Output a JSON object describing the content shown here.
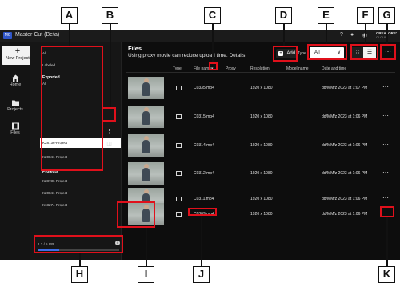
{
  "window": {
    "title": "Master Cut (Beta)",
    "logo_text": "MC",
    "brand_name": "CREATORS'",
    "brand_sub": "CLOUD"
  },
  "nav": {
    "new_project": "New Project",
    "items": [
      {
        "label": "Home",
        "icon": "home-icon"
      },
      {
        "label": "Projects",
        "icon": "folder-icon"
      },
      {
        "label": "Files",
        "icon": "film-icon"
      }
    ]
  },
  "projects_panel": {
    "all": "All",
    "labeled": "Labeled",
    "exported_header": "Exported",
    "exported_all": "All",
    "exported_items": [
      "K28736-Project",
      "K20841-Project"
    ],
    "projects_header": "Projects",
    "project_items": [
      "K28736-Project",
      "K20841-Project",
      "K18274-Project"
    ],
    "storage_text": "1.3 / 5 GB",
    "storage_used_fraction": 0.26
  },
  "main": {
    "title": "Files",
    "subtitle": "Using proxy movie can reduce upload time.",
    "details_link": "Details",
    "add_label": "Add",
    "type_label": "Type",
    "type_value": "All",
    "columns": [
      "Type",
      "File name",
      "Proxy",
      "Resolution",
      "Model name",
      "Date and time"
    ],
    "rows": [
      {
        "file": "C0335.mp4",
        "resolution": "1920 x 1080",
        "date": "dd/MM/z 2023 at 1:07 PM"
      },
      {
        "file": "C0315.mp4",
        "resolution": "1920 x 1080",
        "date": "dd/MM/z 2023 at 1:06 PM"
      },
      {
        "file": "C0314.mp4",
        "resolution": "1920 x 1080",
        "date": "dd/MM/z 2023 at 1:06 PM"
      },
      {
        "file": "C0312.mp4",
        "resolution": "1920 x 1080",
        "date": "dd/MM/z 2023 at 1:06 PM"
      },
      {
        "file": "C0311.mp4",
        "resolution": "1920 x 1080",
        "date": "dd/MM/z 2023 at 1:06 PM"
      },
      {
        "file": "C0309.mp4",
        "resolution": "1920 x 1080",
        "date": "dd/MM/z 2023 at 1:06 PM"
      }
    ]
  },
  "callouts": [
    "A",
    "B",
    "C",
    "D",
    "E",
    "F",
    "G",
    "H",
    "I",
    "J",
    "K"
  ],
  "colors": {
    "highlight": "#e0101b",
    "accent": "#3f6fe8",
    "background": "#0d0d0d"
  }
}
